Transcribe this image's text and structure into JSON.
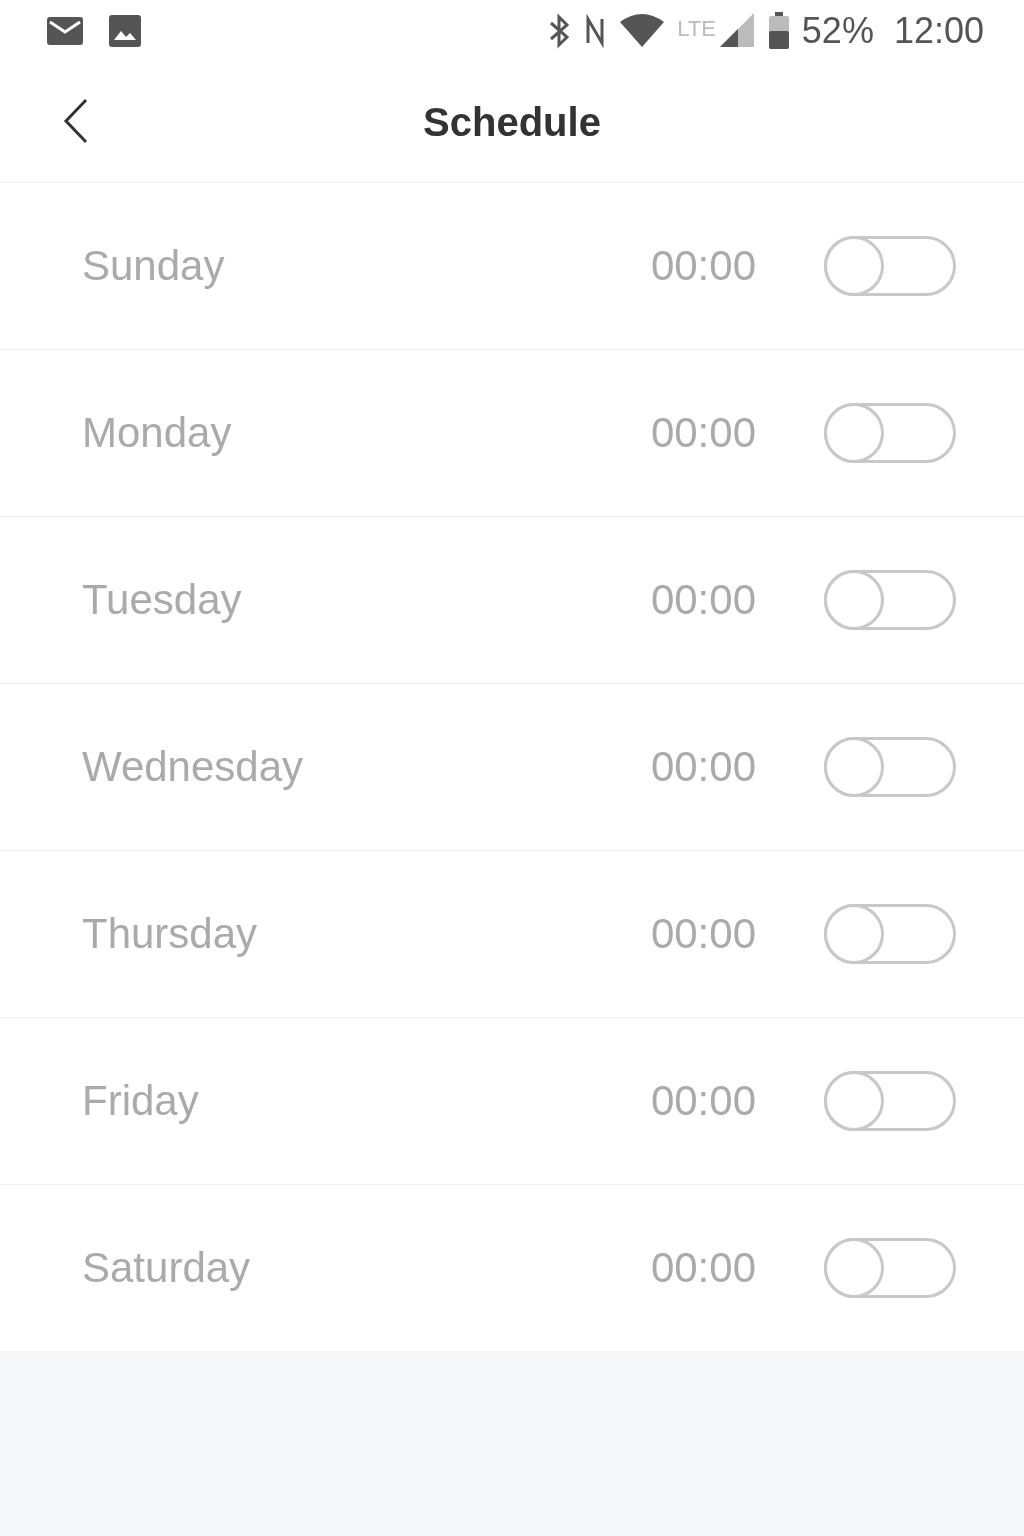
{
  "status_bar": {
    "network": "LTE",
    "battery": "52%",
    "time": "12:00"
  },
  "header": {
    "title": "Schedule"
  },
  "days": [
    {
      "day": "Sunday",
      "time": "00:00",
      "on": false
    },
    {
      "day": "Monday",
      "time": "00:00",
      "on": false
    },
    {
      "day": "Tuesday",
      "time": "00:00",
      "on": false
    },
    {
      "day": "Wednesday",
      "time": "00:00",
      "on": false
    },
    {
      "day": "Thursday",
      "time": "00:00",
      "on": false
    },
    {
      "day": "Friday",
      "time": "00:00",
      "on": false
    },
    {
      "day": "Saturday",
      "time": "00:00",
      "on": false
    }
  ]
}
